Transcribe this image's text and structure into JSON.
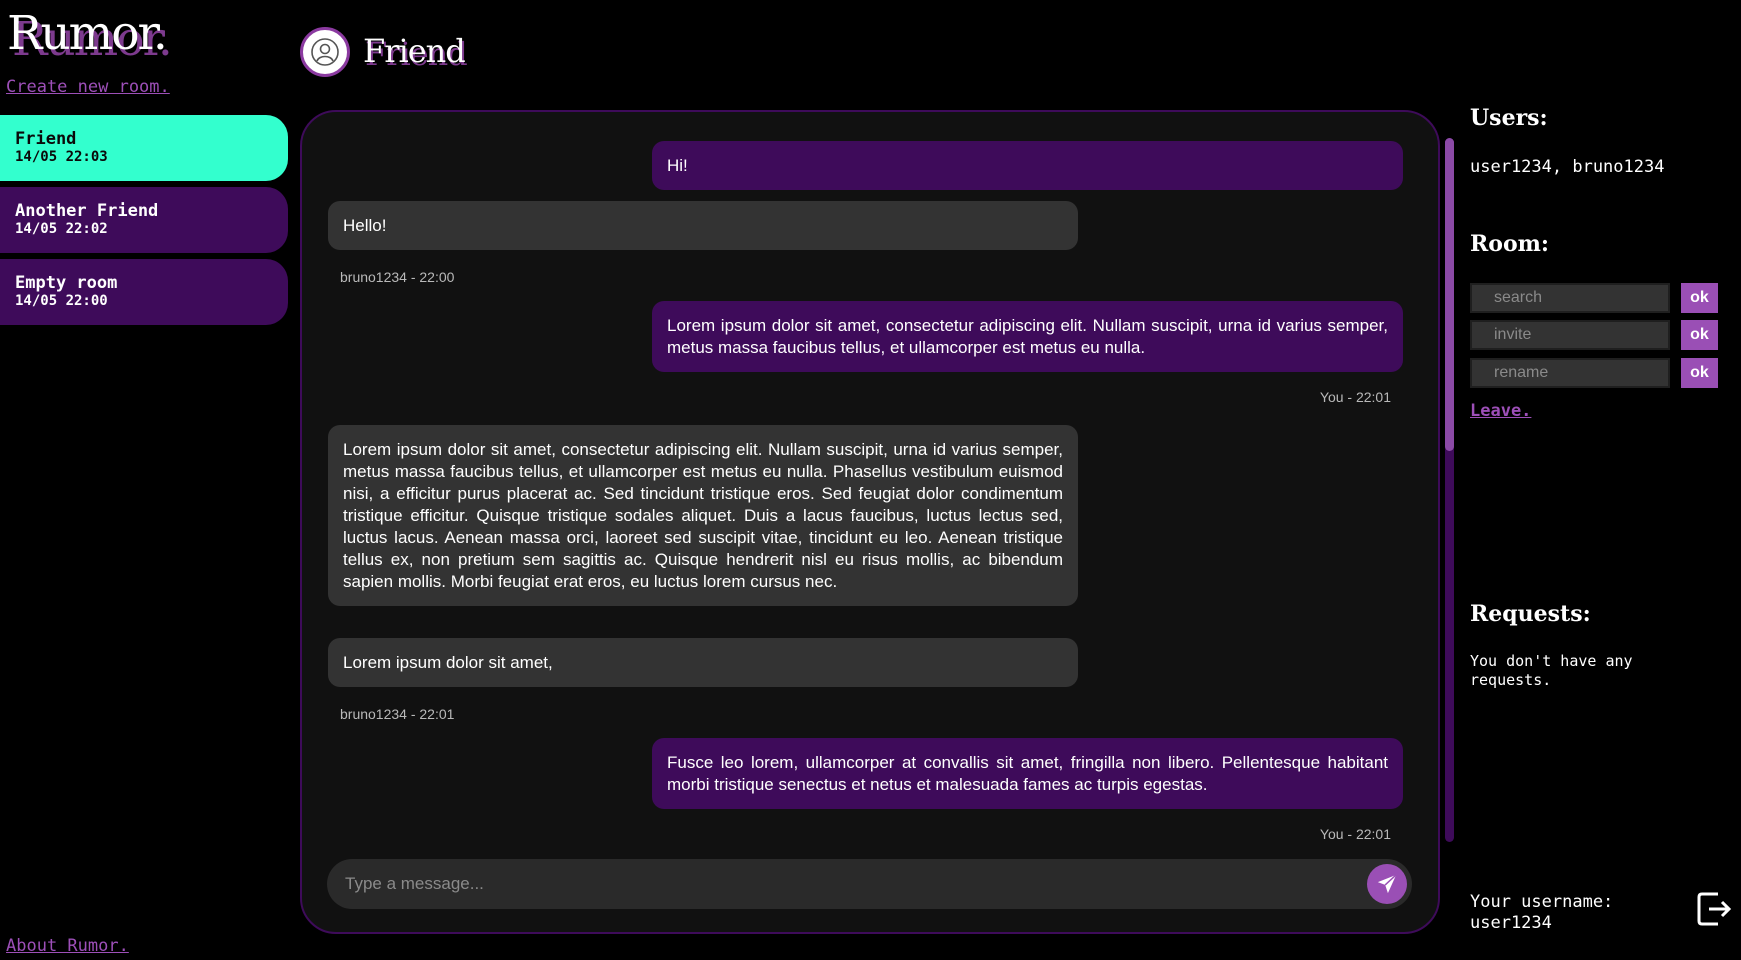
{
  "app": {
    "brand": "Rumor.",
    "create_room_link": "Create new room.",
    "about_link": "About Rumor."
  },
  "sidebar": {
    "rooms": [
      {
        "name": "Friend",
        "time": "14/05 22:03",
        "active": true
      },
      {
        "name": "Another Friend",
        "time": "14/05 22:02",
        "active": false
      },
      {
        "name": "Empty room",
        "time": "14/05 22:00",
        "active": false
      }
    ]
  },
  "chat": {
    "title": "Friend",
    "avatar_icon": "user-circle-icon",
    "messages": [
      {
        "dir": "out",
        "text": "Hi!"
      },
      {
        "dir": "in",
        "text": "Hello!"
      },
      {
        "meta": "bruno1234 - 22:00"
      },
      {
        "dir": "out",
        "text": "Lorem ipsum dolor sit amet, consectetur adipiscing elit. Nullam suscipit, urna id varius semper, metus massa faucibus tellus, et ullamcorper est metus eu nulla."
      },
      {
        "meta": "You - 22:01"
      },
      {
        "dir": "in",
        "text": "Lorem ipsum dolor sit amet, consectetur adipiscing elit. Nullam suscipit, urna id varius semper, metus massa faucibus tellus, et ullamcorper est metus eu nulla. Phasellus vestibulum euismod nisi, a efficitur purus placerat ac. Sed tincidunt tristique eros. Sed feugiat dolor condimentum tristique efficitur. Quisque tristique sodales aliquet. Duis a lacus faucibus, luctus lectus sed, luctus lacus. Aenean massa orci, laoreet sed suscipit vitae, tincidunt eu leo. Aenean tristique tellus ex, non pretium sem sagittis ac. Quisque hendrerit nisl eu risus mollis, ac bibendum sapien mollis. Morbi feugiat erat eros, eu luctus lorem cursus nec."
      },
      {
        "dir": "in",
        "text": "Lorem ipsum dolor sit amet,"
      },
      {
        "meta": "bruno1234 - 22:01"
      },
      {
        "dir": "out",
        "text": "Fusce leo lorem, ullamcorper at convallis sit amet, fringilla non libero. Pellentesque habitant morbi tristique senectus et netus et malesuada fames ac turpis egestas."
      },
      {
        "meta": "You - 22:01"
      }
    ],
    "composer_placeholder": "Type a message...",
    "send_icon": "paper-plane-icon"
  },
  "right_panel": {
    "users_heading": "Users:",
    "users_list": "user1234, bruno1234",
    "room_heading": "Room:",
    "search_placeholder": "search",
    "invite_placeholder": "invite",
    "rename_placeholder": "rename",
    "ok_label": "ok",
    "leave_link": "Leave.",
    "requests_heading": "Requests:",
    "requests_text": "You don't have any requests.",
    "username_label": "Your username:",
    "username_value": "user1234",
    "logout_icon": "logout-icon"
  },
  "colors": {
    "accent_purple": "#3e0b5a",
    "accent_light_purple": "#9a4fb5",
    "active_room": "#33ffce",
    "incoming_bubble": "#333333",
    "panel_bg": "#111111"
  }
}
